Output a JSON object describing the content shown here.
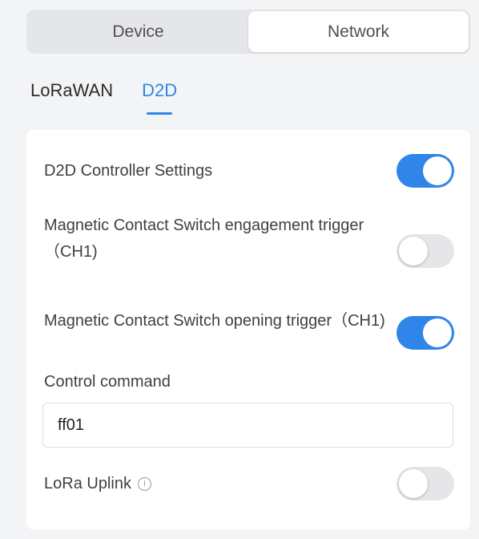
{
  "segmented": {
    "device_label": "Device",
    "network_label": "Network",
    "selected": "Network"
  },
  "tabs": [
    {
      "label": "LoRaWAN",
      "active": false
    },
    {
      "label": "D2D",
      "active": true
    }
  ],
  "settings": {
    "controller": {
      "label": "D2D Controller Settings",
      "enabled": true
    },
    "engagement": {
      "label": "Magnetic Contact Switch engagement trigger（CH1)",
      "enabled": false
    },
    "opening": {
      "label": "Magnetic Contact Switch opening trigger（CH1)",
      "enabled": true
    },
    "control_command": {
      "label": "Control command",
      "value": "ff01"
    },
    "lora_uplink": {
      "label": "LoRa Uplink",
      "info_icon": "info-icon",
      "enabled": false
    }
  },
  "colors": {
    "accent": "#2f86e8",
    "toggle_off": "#e6e6e8",
    "background": "#f3f4f6"
  }
}
